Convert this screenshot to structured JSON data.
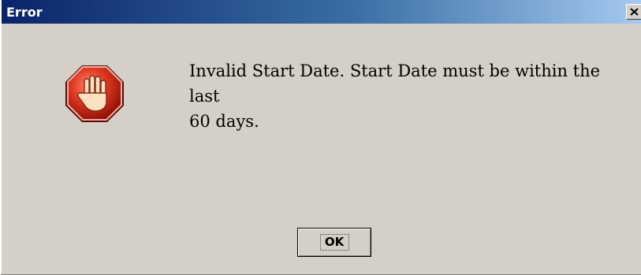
{
  "window": {
    "title": "Error",
    "close_icon": "close-icon",
    "colors": {
      "titlebar_start": "#0a246a",
      "titlebar_end": "#a6caf0",
      "background": "#d4d0c8"
    }
  },
  "dialog": {
    "icon": "stop-hand-icon",
    "message_line1": "Invalid Start Date. Start Date must be within the last",
    "message_line2": "60 days.",
    "ok_label": "OK"
  }
}
